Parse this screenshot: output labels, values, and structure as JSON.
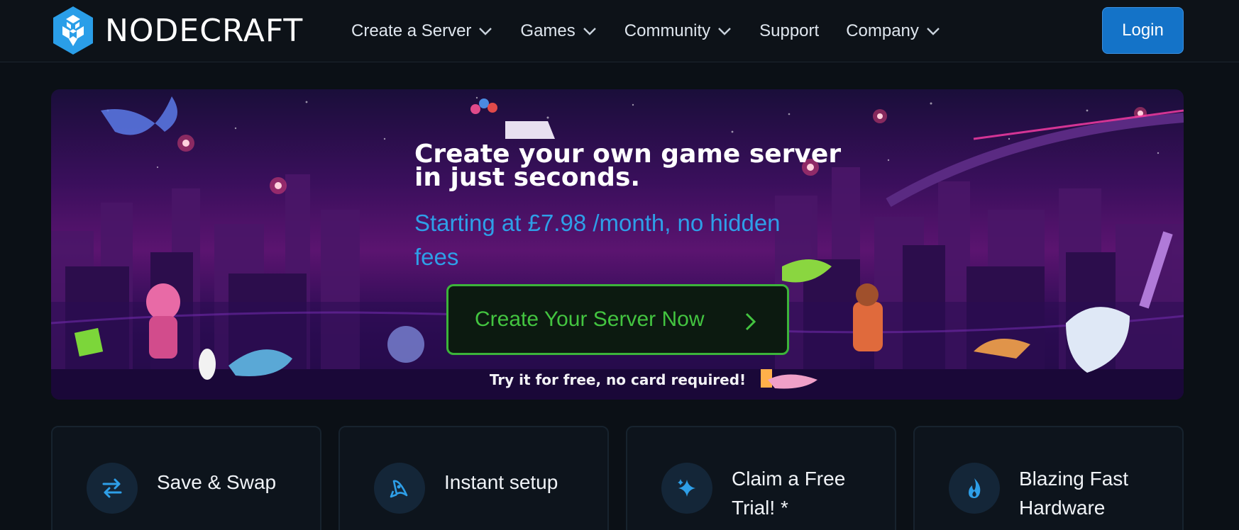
{
  "brand": {
    "name": "NODECRAFT",
    "logo_icon": "nodecraft-hexagon-logo"
  },
  "nav": {
    "items": [
      {
        "label": "Create a Server",
        "has_dropdown": true
      },
      {
        "label": "Games",
        "has_dropdown": true
      },
      {
        "label": "Community",
        "has_dropdown": true
      },
      {
        "label": "Support",
        "has_dropdown": false
      },
      {
        "label": "Company",
        "has_dropdown": true
      }
    ],
    "login_label": "Login"
  },
  "hero": {
    "title_line1": "Create your own game server",
    "title_line2": "in just seconds.",
    "subtitle": "Starting at £7.98 /month, no hidden fees",
    "cta_label": "Create Your Server Now",
    "note": "Try it for free, no card required!"
  },
  "features": [
    {
      "label": "Save & Swap",
      "icon": "swap-arrows-icon"
    },
    {
      "label": "Instant setup",
      "icon": "rocket-icon"
    },
    {
      "label": "Claim a Free Trial! *",
      "icon": "sparkles-icon"
    },
    {
      "label": "Blazing Fast Hardware",
      "icon": "flame-icon"
    }
  ],
  "colors": {
    "accent_blue": "#1473c8",
    "cta_green": "#43c440",
    "subtitle_blue": "#2e9fe8",
    "page_bg": "#0b1016"
  }
}
